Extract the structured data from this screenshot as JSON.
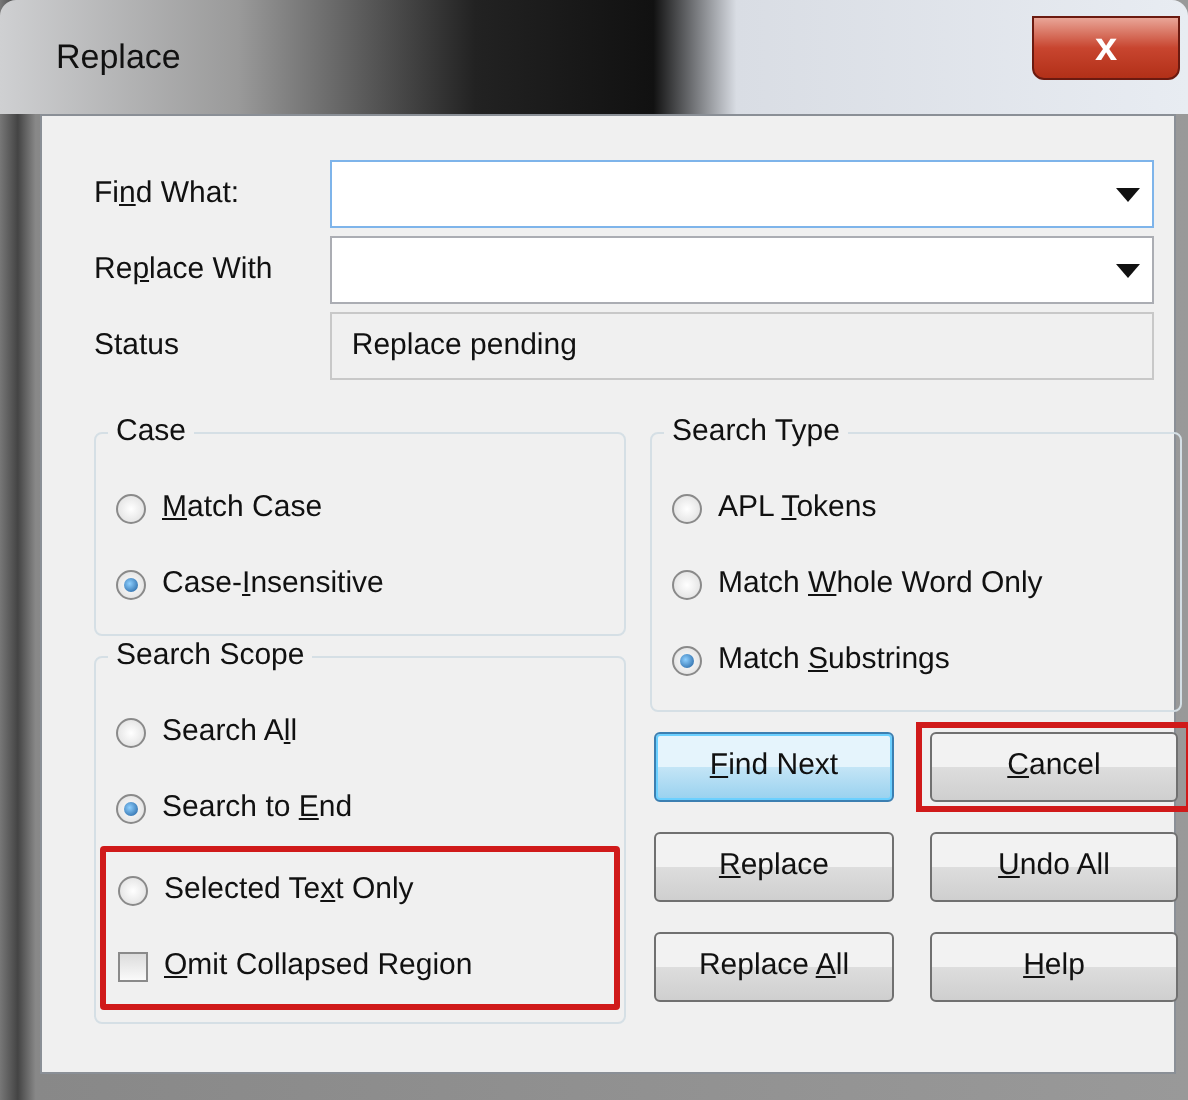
{
  "window": {
    "title": "Replace",
    "close_glyph": "x"
  },
  "fields": [
    {
      "kind": "combo",
      "label": {
        "before": "Fi",
        "key": "n",
        "after": "d What:"
      },
      "focused": true
    },
    {
      "kind": "combo",
      "label": {
        "before": "Re",
        "key": "p",
        "after": "lace With"
      },
      "focused": false
    },
    {
      "kind": "readonly",
      "label": {
        "before": "Status"
      },
      "value": "Replace pending"
    }
  ],
  "case": {
    "title": "Case",
    "options": [
      {
        "kind": "radio",
        "label": {
          "key": "M",
          "after": "atch Case"
        },
        "selected": false,
        "highlighted": false
      },
      {
        "kind": "radio",
        "label": {
          "before": "Case-",
          "key": "I",
          "after": "nsensitive"
        },
        "selected": true,
        "highlighted": false
      }
    ]
  },
  "search_scope": {
    "title": "Search Scope",
    "options": [
      {
        "kind": "radio",
        "label": {
          "before": "Search A",
          "key": "l",
          "after": "l"
        },
        "selected": false,
        "highlighted": false
      },
      {
        "kind": "radio",
        "label": {
          "before": "Search to ",
          "key": "E",
          "after": "nd"
        },
        "selected": true,
        "highlighted": false
      },
      {
        "kind": "radio",
        "label": {
          "before": "Selected Te",
          "key": "x",
          "after": "t Only"
        },
        "selected": false,
        "highlighted": true
      },
      {
        "kind": "checkbox",
        "label": {
          "key": "O",
          "after": "mit Collapsed Region"
        },
        "checked": false,
        "highlighted": true
      }
    ]
  },
  "search_type": {
    "title": "Search Type",
    "options": [
      {
        "kind": "radio",
        "label": {
          "before": "APL ",
          "key": "T",
          "after": "okens"
        },
        "selected": false,
        "highlighted": false
      },
      {
        "kind": "radio",
        "label": {
          "before": "Match ",
          "key": "W",
          "after": "hole Word Only"
        },
        "selected": false,
        "highlighted": false
      },
      {
        "kind": "radio",
        "label": {
          "before": "Match ",
          "key": "S",
          "after": "ubstrings"
        },
        "selected": true,
        "highlighted": false
      }
    ]
  },
  "buttons": [
    {
      "label": {
        "key": "F",
        "after": "ind Next"
      },
      "default": true,
      "highlighted": false
    },
    {
      "label": {
        "key": "C",
        "after": "ancel"
      },
      "default": false,
      "highlighted": true
    },
    {
      "label": {
        "key": "R",
        "after": "eplace"
      },
      "default": false,
      "highlighted": false
    },
    {
      "label": {
        "key": "U",
        "after": "ndo All"
      },
      "default": false,
      "highlighted": false
    },
    {
      "label": {
        "before": "Replace ",
        "key": "A",
        "after": "ll"
      },
      "default": false,
      "highlighted": false
    },
    {
      "label": {
        "key": "H",
        "after": "elp"
      },
      "default": false,
      "highlighted": false
    }
  ]
}
